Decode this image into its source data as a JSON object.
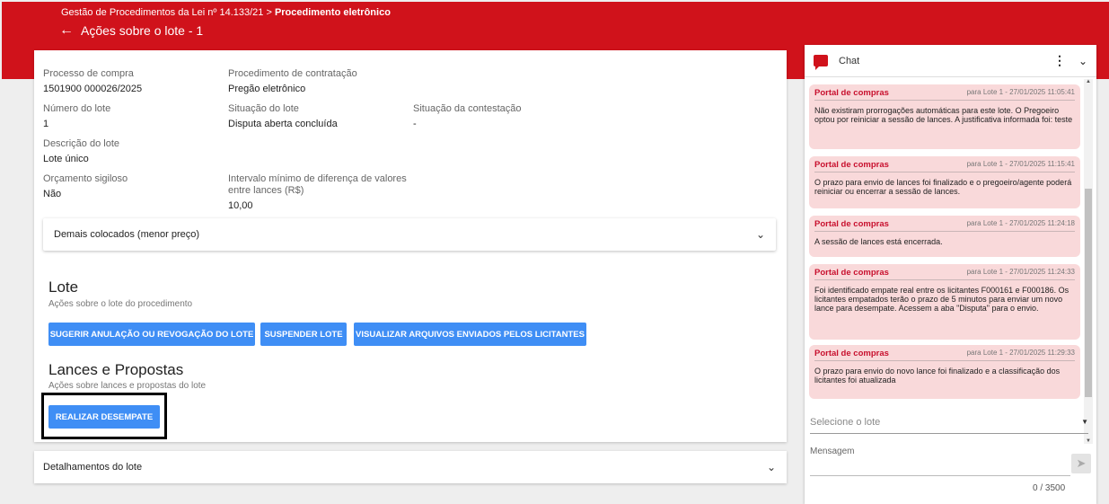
{
  "header": {
    "breadcrumb_prefix": "Gestão de Procedimentos da Lei nº 14.133/21 >",
    "breadcrumb_current": "Procedimento eletrônico",
    "title": "Ações sobre o lote - 1"
  },
  "details": {
    "processo_label": "Processo de compra",
    "processo_value": "1501900 000026/2025",
    "procedimento_label": "Procedimento de contratação",
    "procedimento_value": "Pregão eletrônico",
    "numero_label": "Número do lote",
    "numero_value": "1",
    "situacao_lote_label": "Situação do lote",
    "situacao_lote_value": "Disputa aberta concluída",
    "situacao_contestacao_label": "Situação da contestação",
    "situacao_contestacao_value": "-",
    "descricao_label": "Descrição do lote",
    "descricao_value": "Lote único",
    "orcamento_label": "Orçamento sigiloso",
    "orcamento_value": "Não",
    "intervalo_label": "Intervalo mínimo de diferença de valores entre lances (R$)",
    "intervalo_value": "10,00"
  },
  "demais": {
    "label": "Demais colocados (menor preço)"
  },
  "lote": {
    "title": "Lote",
    "subtitle": "Ações sobre o lote do procedimento",
    "btn_anulacao": "SUGERIR ANULAÇÃO OU REVOGAÇÃO DO LOTE",
    "btn_suspender": "SUSPENDER LOTE",
    "btn_visualizar": "VISUALIZAR ARQUIVOS ENVIADOS PELOS LICITANTES"
  },
  "lances": {
    "title": "Lances e Propostas",
    "subtitle": "Ações sobre lances e propostas do lote",
    "btn_desempate": "REALIZAR DESEMPATE"
  },
  "detalhamentos": {
    "label": "Detalhamentos do lote"
  },
  "chat": {
    "title": "Chat",
    "messages": [
      {
        "sender": "Portal de compras",
        "meta": "para Lote 1  -  27/01/2025 11:05:41",
        "text": "Não existiram prorrogações automáticas para este lote. O Pregoeiro optou por reiniciar a sessão de lances. A justificativa informada foi: teste"
      },
      {
        "sender": "Portal de compras",
        "meta": "para Lote 1  -  27/01/2025 11:15:41",
        "text": "O prazo para envio de lances foi finalizado e o pregoeiro/agente poderá reiniciar ou encerrar a sessão de lances."
      },
      {
        "sender": "Portal de compras",
        "meta": "para Lote 1  -  27/01/2025 11:24:18",
        "text": "A sessão de lances está encerrada."
      },
      {
        "sender": "Portal de compras",
        "meta": "para Lote 1  -  27/01/2025 11:24:33",
        "text": "Foi identificado empate real entre os licitantes F000161 e F000186. Os licitantes empatados terão o prazo de 5 minutos para enviar um novo lance para desempate. Acessem a aba \"Disputa\" para o envio."
      },
      {
        "sender": "Portal de compras",
        "meta": "para Lote 1  -  27/01/2025 11:29:33",
        "text": "O prazo para envio do novo lance foi finalizado e a classificação dos licitantes foi atualizada"
      }
    ],
    "select_placeholder": "Selecione o lote",
    "message_label": "Mensagem",
    "counter": "0 / 3500"
  }
}
